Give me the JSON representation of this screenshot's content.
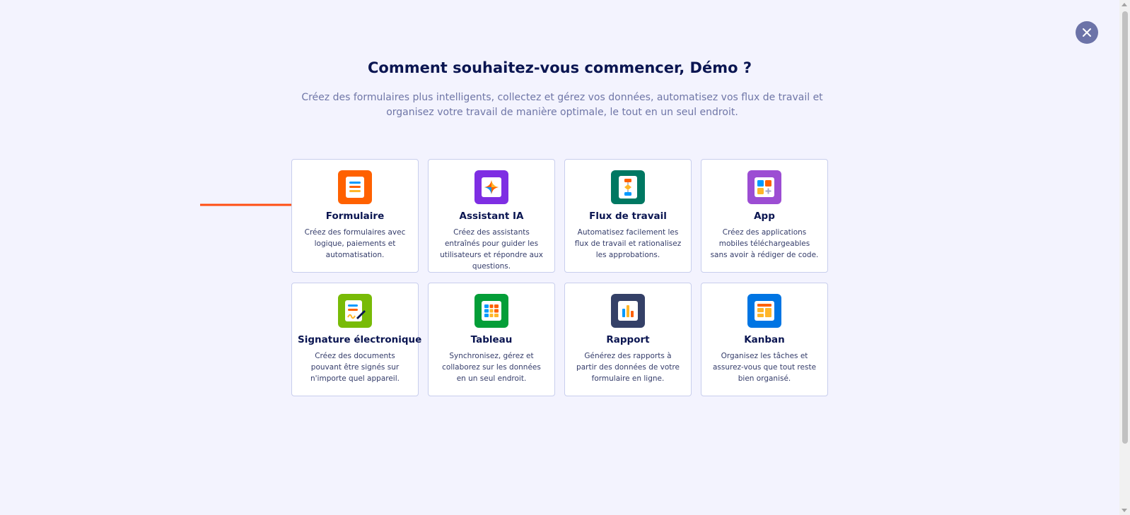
{
  "header": {
    "title": "Comment souhaitez-vous commencer, Démo ?",
    "subtitle": "Créez des formulaires plus intelligents, collectez et gérez vos données, automatisez vos flux de travail et organisez votre travail de manière optimale, le tout en un seul endroit."
  },
  "close_button": {
    "icon": "close-icon"
  },
  "options": [
    {
      "title": "Formulaire",
      "description": "Créez des formulaires avec logique, paiements et automatisation.",
      "icon": "form-icon",
      "color": "#ff6100"
    },
    {
      "title": "Assistant IA",
      "description": "Créez des assistants entraînés pour guider les utilisateurs et répondre aux questions.",
      "icon": "ai-sparkle-icon",
      "color": "#7e2ee3"
    },
    {
      "title": "Flux de travail",
      "description": "Automatisez facilement les flux de travail et rationalisez les approbations.",
      "icon": "workflow-icon",
      "color": "#007862"
    },
    {
      "title": "App",
      "description": "Créez des applications mobiles téléchargeables sans avoir à rédiger de code.",
      "icon": "app-icon",
      "color": "#9c4dd3"
    },
    {
      "title": "Signature électronique",
      "description": "Créez des documents pouvant être signés sur n'importe quel appareil.",
      "icon": "signature-icon",
      "color": "#78bb07"
    },
    {
      "title": "Tableau",
      "description": "Synchronisez, gérez et collaborez sur les données en un seul endroit.",
      "icon": "table-icon",
      "color": "#049e38"
    },
    {
      "title": "Rapport",
      "description": "Générez des rapports à partir des données de votre formulaire en ligne.",
      "icon": "report-icon",
      "color": "#344067"
    },
    {
      "title": "Kanban",
      "description": "Organisez les tâches et assurez-vous que tout reste bien organisé.",
      "icon": "kanban-icon",
      "color": "#0075e3"
    }
  ],
  "annotation": {
    "icon": "arrow-right-icon",
    "color": "#ff4e12"
  }
}
